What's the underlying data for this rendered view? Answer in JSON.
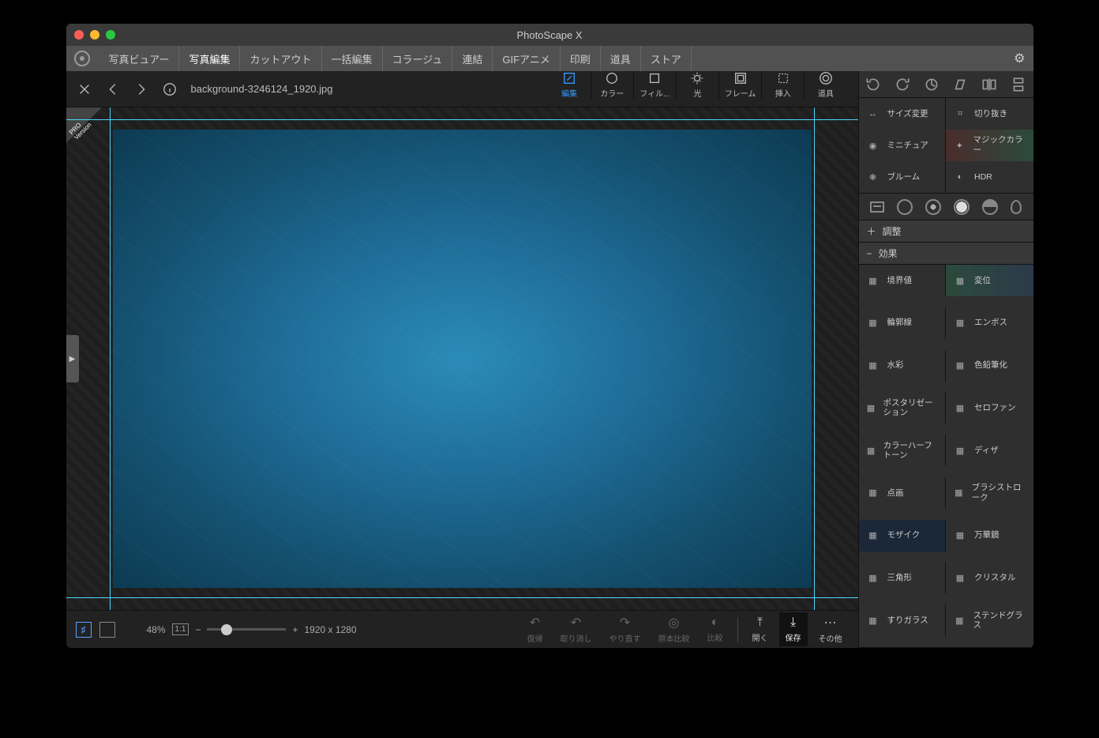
{
  "window": {
    "title": "PhotoScape X"
  },
  "tabs": [
    "写真ビュアー",
    "写真編集",
    "カットアウト",
    "一括編集",
    "コラージュ",
    "連結",
    "GIFアニメ",
    "印刷",
    "道具",
    "ストア"
  ],
  "active_tab_index": 1,
  "file": {
    "name": "background-3246124_1920.jpg"
  },
  "pro_label": "PRO Version",
  "tool_tabs": [
    {
      "key": "edit",
      "label": "編集"
    },
    {
      "key": "color",
      "label": "カラー"
    },
    {
      "key": "filter",
      "label": "フィル..."
    },
    {
      "key": "light",
      "label": "光"
    },
    {
      "key": "frame",
      "label": "フレーム"
    },
    {
      "key": "insert",
      "label": "挿入"
    },
    {
      "key": "tools",
      "label": "道具"
    }
  ],
  "active_tool_tab": 0,
  "transform_buttons": [
    "rotate-left",
    "rotate-right",
    "rotate-arb",
    "skew",
    "flip-h",
    "flip-v"
  ],
  "quick_tools": [
    {
      "label": "サイズ変更",
      "icon": "resize"
    },
    {
      "label": "切り抜き",
      "icon": "crop"
    },
    {
      "label": "ミニチュア",
      "icon": "miniature"
    },
    {
      "label": "マジックカラー",
      "icon": "magic",
      "hl": true
    },
    {
      "label": "ブルーム",
      "icon": "bloom"
    },
    {
      "label": "HDR",
      "icon": "hdr"
    }
  ],
  "shape_row": [
    "square",
    "circle-1",
    "circle-2",
    "circle-3",
    "circle-4",
    "drop"
  ],
  "accordion": {
    "adjust": "調整",
    "effect": "効果"
  },
  "effects": [
    {
      "label": "境界値",
      "icon": "threshold"
    },
    {
      "label": "変位",
      "icon": "displace",
      "hl2": true
    },
    {
      "label": "輪郭線",
      "icon": "outline"
    },
    {
      "label": "エンボス",
      "icon": "emboss"
    },
    {
      "label": "水彩",
      "icon": "watercolor"
    },
    {
      "label": "色鉛筆化",
      "icon": "pencil"
    },
    {
      "label": "ポスタリゼーション",
      "icon": "posterize"
    },
    {
      "label": "セロファン",
      "icon": "cellophane"
    },
    {
      "label": "カラーハーフトーン",
      "icon": "halftone"
    },
    {
      "label": "ディザ",
      "icon": "dither"
    },
    {
      "label": "点画",
      "icon": "stipple"
    },
    {
      "label": "ブラシストローク",
      "icon": "brush"
    },
    {
      "label": "モザイク",
      "icon": "mosaic",
      "sel": true
    },
    {
      "label": "万華鏡",
      "icon": "kaleido"
    },
    {
      "label": "三角形",
      "icon": "triangle"
    },
    {
      "label": "クリスタル",
      "icon": "crystal"
    },
    {
      "label": "すりガラス",
      "icon": "frosted"
    },
    {
      "label": "ステンドグラス",
      "icon": "stained"
    }
  ],
  "status": {
    "zoom_pct": "48%",
    "one_to_one": "1:1",
    "dimensions": "1920 x 1280"
  },
  "bottom_actions": [
    {
      "key": "undo-all",
      "label": "復帰",
      "enabled": false
    },
    {
      "key": "undo",
      "label": "取り消し",
      "enabled": false
    },
    {
      "key": "redo",
      "label": "やり直す",
      "enabled": false
    },
    {
      "key": "compare",
      "label": "原本比較",
      "enabled": false
    },
    {
      "key": "diff",
      "label": "比較",
      "enabled": false
    },
    {
      "key": "open",
      "label": "開く",
      "enabled": true
    },
    {
      "key": "save",
      "label": "保存",
      "enabled": true,
      "hl": true
    },
    {
      "key": "more",
      "label": "その他",
      "enabled": true
    }
  ]
}
